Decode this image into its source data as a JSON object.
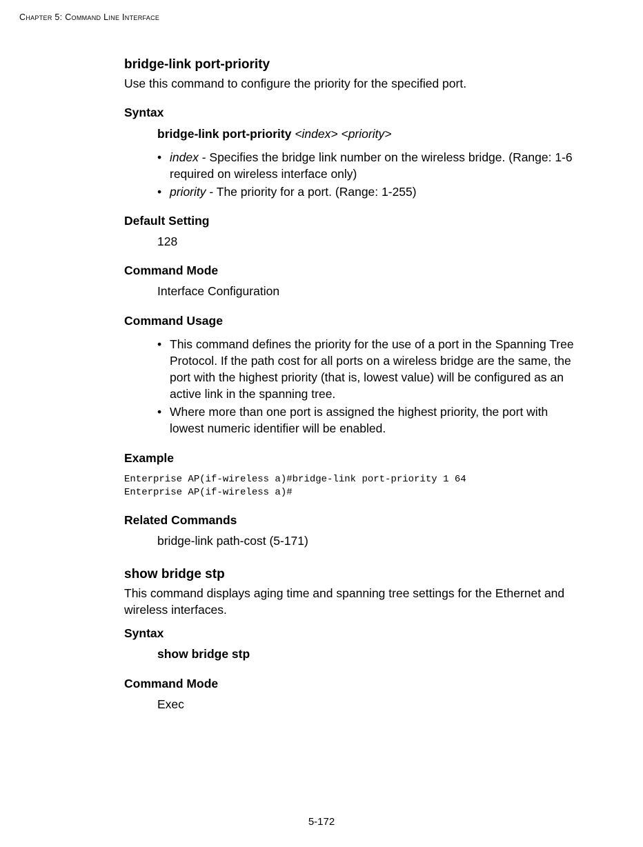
{
  "header": "Chapter 5: Command Line Interface",
  "cmd1": {
    "title": "bridge-link port-priority",
    "desc": "Use this command to configure the priority for the specified port.",
    "syntax_label": "Syntax",
    "syntax_bold": "bridge-link port-priority",
    "syntax_arg1": "<index>",
    "syntax_arg2": "<priority>",
    "param1_name": "index",
    "param1_text": " - Specifies the bridge link number on the wireless bridge. (Range: 1-6 required on wireless interface only)",
    "param2_name": "priority",
    "param2_text": " - The priority for a port. (Range: 1-255)",
    "default_label": "Default Setting",
    "default_value": "128",
    "mode_label": "Command Mode",
    "mode_value": "Interface Configuration",
    "usage_label": "Command Usage",
    "usage_item1": "This command defines the priority for the use of a port in the Spanning Tree Protocol. If the path cost for all ports on a wireless bridge are the same, the port with the highest priority (that is, lowest value) will be configured as an active link in the spanning tree.",
    "usage_item2": "Where more than one port is assigned the highest priority, the port with lowest numeric identifier will be enabled.",
    "example_label": "Example",
    "example_code": "Enterprise AP(if-wireless a)#bridge-link port-priority 1 64\nEnterprise AP(if-wireless a)#",
    "related_label": "Related Commands",
    "related_text": "bridge-link path-cost (5-171)"
  },
  "cmd2": {
    "title": "show bridge stp",
    "desc": "This command displays aging time and spanning tree settings for the Ethernet and  wireless interfaces.",
    "syntax_label": "Syntax",
    "syntax_text": "show bridge stp",
    "mode_label": "Command Mode",
    "mode_value": "Exec"
  },
  "footer": "5-172"
}
